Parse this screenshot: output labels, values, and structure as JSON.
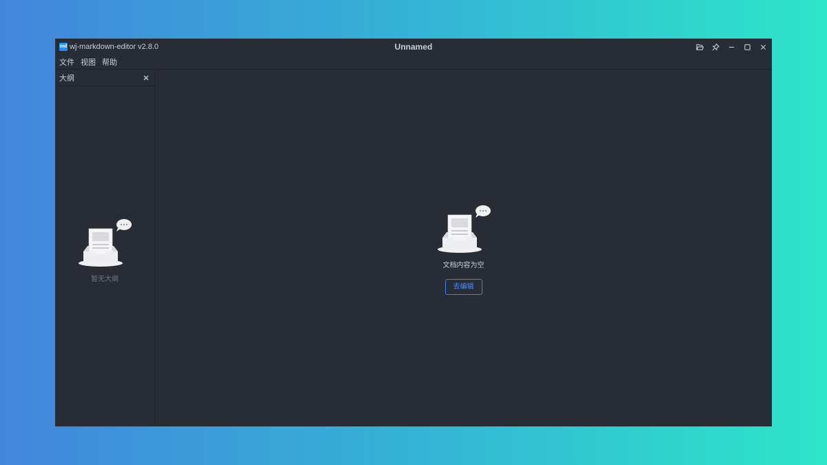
{
  "window": {
    "app_logo": "md",
    "app_name": "wj-markdown-editor v2.8.0",
    "doc_title": "Unnamed",
    "controls": {
      "open_folder_icon": "folder-open-icon",
      "pin_icon": "pin-icon",
      "minimize_icon": "minimize-icon",
      "maximize_icon": "maximize-icon",
      "close_icon": "close-icon"
    }
  },
  "menubar": {
    "items": [
      {
        "label": "文件"
      },
      {
        "label": "视图"
      },
      {
        "label": "帮助"
      }
    ]
  },
  "sidebar": {
    "title": "大纲",
    "empty_text": "暂无大纲"
  },
  "main": {
    "empty_text": "文档内容为空",
    "edit_button": "去编辑"
  },
  "colors": {
    "window_bg": "#282c34",
    "accent": "#3a82f6",
    "text": "#c9ced6"
  }
}
